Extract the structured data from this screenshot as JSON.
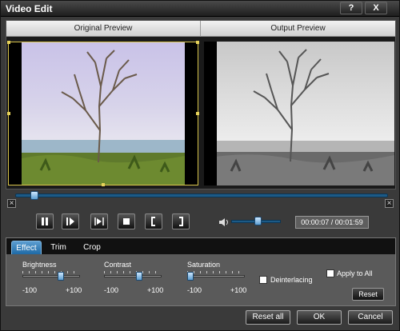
{
  "window": {
    "title": "Video Edit",
    "help_label": "?",
    "close_label": "X"
  },
  "preview": {
    "original_label": "Original Preview",
    "output_label": "Output Preview"
  },
  "playback": {
    "time": "00:00:07 / 00:01:59",
    "seek_progress": 0.05,
    "volume_level": 0.5,
    "buttons": [
      "play-pause",
      "next-frame",
      "snapshot",
      "stop",
      "start-marker",
      "end-marker"
    ]
  },
  "tabs": [
    "Effect",
    "Trim",
    "Crop"
  ],
  "active_tab": "Effect",
  "effect": {
    "brightness": {
      "label": "Brightness",
      "min": "-100",
      "max": "+100",
      "value": 0
    },
    "contrast": {
      "label": "Contrast",
      "min": "-100",
      "max": "+100",
      "value": 0
    },
    "saturation": {
      "label": "Saturation",
      "min": "-100",
      "max": "+100",
      "value": -100
    },
    "deinterlacing_label": "Deinterlacing",
    "apply_to_all_label": "Apply to All",
    "reset_label": "Reset"
  },
  "footer": {
    "reset_all_label": "Reset all",
    "ok_label": "OK",
    "cancel_label": "Cancel"
  },
  "colors": {
    "accent": "#2d78b8",
    "selection_border": "#d8c44a"
  }
}
